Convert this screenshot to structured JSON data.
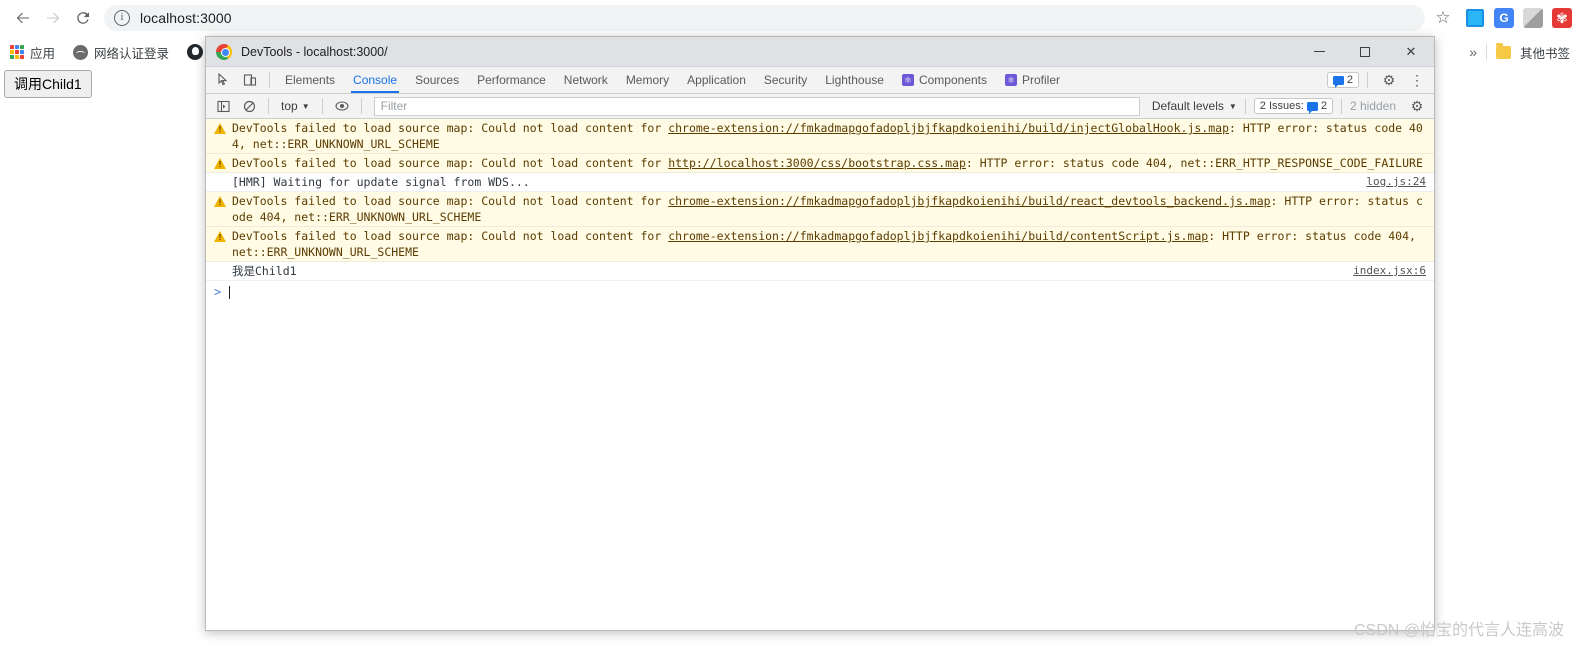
{
  "browser": {
    "back_label": "Back",
    "forward_label": "Forward",
    "reload_label": "Reload",
    "url": "localhost:3000",
    "star_label": "Bookmark this page",
    "extensions": [
      "extension-icon-1",
      "extension-icon-2",
      "extension-icon-3",
      "extension-icon-4"
    ]
  },
  "bookmarks": {
    "apps_label": "应用",
    "items": [
      {
        "label": "网络认证登录",
        "icon": "globe-icon"
      },
      {
        "label": "",
        "icon": "github-icon"
      }
    ],
    "overflow_label": "»",
    "other_bookmarks_label": "其他书签"
  },
  "page": {
    "button_label": "调用Child1"
  },
  "devtools": {
    "window_title": "DevTools - localhost:3000/",
    "window_controls": {
      "minimize": "Minimize",
      "maximize": "Maximize",
      "close": "Close"
    },
    "toolbar_icons": {
      "inspect": "inspect-element-icon",
      "device": "device-toolbar-icon"
    },
    "tabs": [
      {
        "label": "Elements",
        "active": false,
        "icon": null
      },
      {
        "label": "Console",
        "active": true,
        "icon": null
      },
      {
        "label": "Sources",
        "active": false,
        "icon": null
      },
      {
        "label": "Performance",
        "active": false,
        "icon": null
      },
      {
        "label": "Network",
        "active": false,
        "icon": null
      },
      {
        "label": "Memory",
        "active": false,
        "icon": null
      },
      {
        "label": "Application",
        "active": false,
        "icon": null
      },
      {
        "label": "Security",
        "active": false,
        "icon": null
      },
      {
        "label": "Lighthouse",
        "active": false,
        "icon": null
      },
      {
        "label": "Components",
        "active": false,
        "icon": "react-icon"
      },
      {
        "label": "Profiler",
        "active": false,
        "icon": "react-icon"
      }
    ],
    "tab_badge_count": "2",
    "settings_label": "Settings",
    "more_label": "More options",
    "console_toolbar": {
      "sidebar_toggle": "console-sidebar-toggle-icon",
      "clear_label": "clear-console-icon",
      "context": "top",
      "eye_label": "live-expression-icon",
      "filter_placeholder": "Filter",
      "filter_value": "",
      "levels_label": "Default levels",
      "issues_label": "2 Issues:",
      "issues_count": "2",
      "hidden_label": "2 hidden",
      "settings_label": "Console settings"
    },
    "messages": [
      {
        "type": "warn",
        "pre": "DevTools failed to load source map: Could not load content for ",
        "link": "chrome-extension://fmkadmapgofadopljbjfkapdkoienihi/build/injectGlobalHook.js.map",
        "post": ": HTTP error: status code 404, net::ERR_UNKNOWN_URL_SCHEME",
        "source": ""
      },
      {
        "type": "warn",
        "pre": "DevTools failed to load source map: Could not load content for ",
        "link": "http://localhost:3000/css/bootstrap.css.map",
        "post": ": HTTP error: status code 404, net::ERR_HTTP_RESPONSE_CODE_FAILURE",
        "source": ""
      },
      {
        "type": "info",
        "pre": "[HMR] Waiting for update signal from WDS...",
        "link": "",
        "post": "",
        "source": "log.js:24"
      },
      {
        "type": "warn",
        "pre": "DevTools failed to load source map: Could not load content for ",
        "link": "chrome-extension://fmkadmapgofadopljbjfkapdkoienihi/build/react_devtools_backend.js.map",
        "post": ": HTTP error: status code 404, net::ERR_UNKNOWN_URL_SCHEME",
        "source": ""
      },
      {
        "type": "warn",
        "pre": "DevTools failed to load source map: Could not load content for ",
        "link": "chrome-extension://fmkadmapgofadopljbjfkapdkoienihi/build/contentScript.js.map",
        "post": ": HTTP error: status code 404, net::ERR_UNKNOWN_URL_SCHEME",
        "source": ""
      },
      {
        "type": "log",
        "pre": "我是Child1",
        "link": "",
        "post": "",
        "source": "index.jsx:6"
      }
    ],
    "prompt_caret": ">",
    "prompt_value": ""
  },
  "watermark": "CSDN @怡宝的代言人连高波",
  "colors": {
    "accent": "#1a73e8",
    "warning_bg": "#fffbe5",
    "warning_text": "#5c3c00",
    "warning_icon": "#f0b400"
  }
}
